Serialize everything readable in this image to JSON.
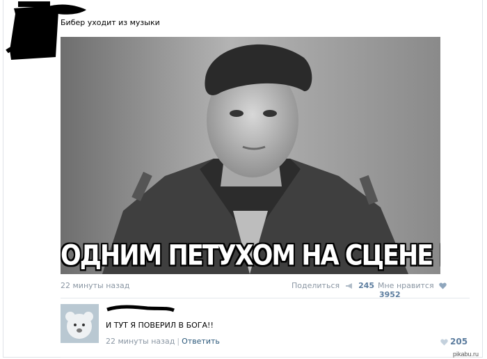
{
  "post": {
    "text": "Бибер уходит из музыки",
    "image_caption": "ОДНИМ ПЕТУХОМ НА СЦЕНЕ МЕНЬШЕ",
    "time": "22 минуты назад",
    "share_label": "Поделиться",
    "share_count": "245",
    "like_label": "Мне нравится",
    "like_count": "3952"
  },
  "comment": {
    "text": "И ТУТ Я ПОВЕРИЛ В БОГА!!",
    "time": "22 минуты назад",
    "separator": "|",
    "reply_label": "Ответить",
    "like_count": "205"
  },
  "watermark": "pikabu.ru",
  "icons": {
    "share": "megaphone-icon",
    "like": "heart-icon"
  },
  "colors": {
    "link": "#2b587a",
    "meta": "#8a96a3",
    "count": "#5b7c9e"
  }
}
